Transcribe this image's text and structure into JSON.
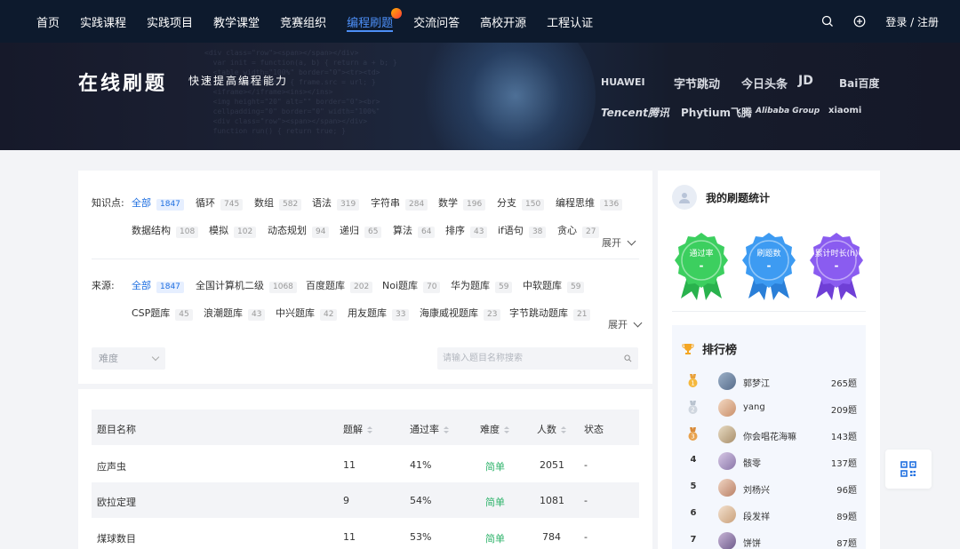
{
  "nav": {
    "items": [
      {
        "label": "首页",
        "active": false
      },
      {
        "label": "实践课程",
        "active": false
      },
      {
        "label": "实践项目",
        "active": false
      },
      {
        "label": "教学课堂",
        "active": false
      },
      {
        "label": "竞赛组织",
        "active": false
      },
      {
        "label": "编程刷题",
        "active": true
      },
      {
        "label": "交流问答",
        "active": false
      },
      {
        "label": "高校开源",
        "active": false
      },
      {
        "label": "工程认证",
        "active": false
      }
    ],
    "login_label": "登录 / 注册"
  },
  "banner": {
    "title": "在线刷题",
    "subtitle": "快速提高编程能力",
    "logos": [
      "HUAWEI",
      "字节跳动",
      "今日头条",
      "JD",
      "Bai百度",
      "Tencent腾讯",
      "Phytium飞腾",
      "Alibaba Group",
      "xiaomi"
    ]
  },
  "filters": {
    "knowledge_label": "知识点:",
    "knowledge_tags": [
      {
        "name": "全部",
        "count": "1847",
        "selected": true
      },
      {
        "name": "循环",
        "count": "745"
      },
      {
        "name": "数组",
        "count": "582"
      },
      {
        "name": "语法",
        "count": "319"
      },
      {
        "name": "字符串",
        "count": "284"
      },
      {
        "name": "数学",
        "count": "196"
      },
      {
        "name": "分支",
        "count": "150"
      },
      {
        "name": "编程思维",
        "count": "136"
      },
      {
        "name": "数据结构",
        "count": "108"
      },
      {
        "name": "模拟",
        "count": "102"
      },
      {
        "name": "动态规划",
        "count": "94"
      },
      {
        "name": "递归",
        "count": "65"
      },
      {
        "name": "算法",
        "count": "64"
      },
      {
        "name": "排序",
        "count": "43"
      },
      {
        "name": "if语句",
        "count": "38"
      },
      {
        "name": "贪心",
        "count": "27"
      }
    ],
    "source_label": "来源:",
    "source_tags": [
      {
        "name": "全部",
        "count": "1847",
        "selected": true
      },
      {
        "name": "全国计算机二级",
        "count": "1068"
      },
      {
        "name": "百度题库",
        "count": "202"
      },
      {
        "name": "Noi题库",
        "count": "70"
      },
      {
        "name": "华为题库",
        "count": "59"
      },
      {
        "name": "中软题库",
        "count": "59"
      },
      {
        "name": "CSP题库",
        "count": "45"
      },
      {
        "name": "浪潮题库",
        "count": "43"
      },
      {
        "name": "中兴题库",
        "count": "42"
      },
      {
        "name": "用友题库",
        "count": "33"
      },
      {
        "name": "海康威视题库",
        "count": "23"
      },
      {
        "name": "字节跳动题库",
        "count": "21"
      }
    ],
    "expand_label": "展开",
    "difficulty_placeholder": "难度",
    "search_placeholder": "请输入题目名称搜索"
  },
  "table": {
    "headers": {
      "name": "题目名称",
      "solved": "题解",
      "pass_rate": "通过率",
      "difficulty": "难度",
      "people": "人数",
      "status": "状态"
    },
    "rows": [
      {
        "name": "应声虫",
        "solved": "11",
        "pass_rate": "41%",
        "difficulty": "简单",
        "people": "2051",
        "status": "-"
      },
      {
        "name": "欧拉定理",
        "solved": "9",
        "pass_rate": "54%",
        "difficulty": "简单",
        "people": "1081",
        "status": "-"
      },
      {
        "name": "煤球数目",
        "solved": "11",
        "pass_rate": "53%",
        "difficulty": "简单",
        "people": "784",
        "status": "-"
      }
    ]
  },
  "stats": {
    "title": "我的刷题统计",
    "badges": [
      {
        "label": "通过率",
        "value": "-",
        "color": "#3ccf5f"
      },
      {
        "label": "刷题数",
        "value": "-",
        "color": "#3d9bf2"
      },
      {
        "label": "累计时长(h)",
        "value": "-",
        "color": "#8a5cf0"
      }
    ]
  },
  "leaderboard": {
    "title": "排行榜",
    "rows": [
      {
        "rank": "1",
        "name": "郭梦江",
        "score": "265题"
      },
      {
        "rank": "2",
        "name": "yang",
        "score": "209题"
      },
      {
        "rank": "3",
        "name": "你会唱花海嘛",
        "score": "143题"
      },
      {
        "rank": "4",
        "name": "骸零",
        "score": "137题"
      },
      {
        "rank": "5",
        "name": "刘杨兴",
        "score": "96题"
      },
      {
        "rank": "6",
        "name": "段发祥",
        "score": "89题"
      },
      {
        "rank": "7",
        "name": "饼饼",
        "score": "87题"
      }
    ]
  }
}
